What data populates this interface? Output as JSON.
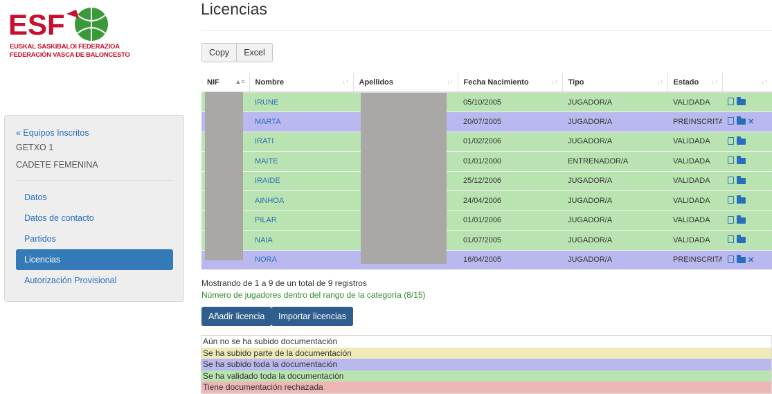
{
  "logo": {
    "acronym": "ESF",
    "line1": "EUSKAL SASKIBALOI FEDERAZIOA",
    "line2": "FEDERACIÓN VASCA DE BALONCESTO"
  },
  "sidebar": {
    "back_link": "« Equipos Inscritos",
    "team": "GETXO 1",
    "category": "CADETE FEMENINA",
    "items": [
      {
        "label": "Datos"
      },
      {
        "label": "Datos de contacto"
      },
      {
        "label": "Partidos"
      },
      {
        "label": "Licencias"
      },
      {
        "label": "Autorización Provisional"
      }
    ]
  },
  "main": {
    "title": "Licencias",
    "export_buttons": {
      "copy": "Copy",
      "excel": "Excel"
    },
    "table": {
      "columns": [
        "NIF",
        "Nombre",
        "Apellidos",
        "Fecha Nacimiento",
        "Tipo",
        "Estado",
        ""
      ],
      "rows": [
        {
          "nif": "",
          "nombre": "IRUNE",
          "apellidos": "",
          "fecha": "05/10/2005",
          "tipo": "JUGADOR/A",
          "estado": "VALIDADA"
        },
        {
          "nif": "",
          "nombre": "MARTA",
          "apellidos": "",
          "fecha": "20/07/2005",
          "tipo": "JUGADOR/A",
          "estado": "PREINSCRITA"
        },
        {
          "nif": "",
          "nombre": "IRATI",
          "apellidos": "",
          "fecha": "01/02/2006",
          "tipo": "JUGADOR/A",
          "estado": "VALIDADA"
        },
        {
          "nif": "",
          "nombre": "MAITE",
          "apellidos": "",
          "fecha": "01/01/2000",
          "tipo": "ENTRENADOR/A",
          "estado": "VALIDADA"
        },
        {
          "nif": "",
          "nombre": "IRAIDE",
          "apellidos": "",
          "fecha": "25/12/2006",
          "tipo": "JUGADOR/A",
          "estado": "VALIDADA"
        },
        {
          "nif": "",
          "nombre": "AINHOA",
          "apellidos": "",
          "fecha": "24/04/2006",
          "tipo": "JUGADOR/A",
          "estado": "VALIDADA"
        },
        {
          "nif": "",
          "nombre": "PILAR",
          "apellidos": "",
          "fecha": "01/01/2006",
          "tipo": "JUGADOR/A",
          "estado": "VALIDADA"
        },
        {
          "nif": "",
          "nombre": "NAIA",
          "apellidos": "",
          "fecha": "01/07/2005",
          "tipo": "JUGADOR/A",
          "estado": "VALIDADA"
        },
        {
          "nif": "",
          "nombre": "NORA",
          "apellidos": "",
          "fecha": "16/04/2005",
          "tipo": "JUGADOR/A",
          "estado": "PREINSCRITA"
        }
      ]
    },
    "info": "Mostrando de 1 a 9 de un total de 9 registros",
    "range_note": "Número de jugadores dentro del rango de la categoría (8/15)",
    "add_button": "Añadir licencia",
    "import_button": "Importar licencias",
    "legend": [
      {
        "label": "Aún no se ha subido documentación",
        "color": "#ffffff"
      },
      {
        "label": "Se ha subido parte de la documentación",
        "color": "#efeab8"
      },
      {
        "label": "Se ha subido toda la documentación",
        "color": "#b9b9ef"
      },
      {
        "label": "Se ha validado toda la documentación",
        "color": "#b9e3b0"
      },
      {
        "label": "Tiene documentación rechazada",
        "color": "#efb6b6"
      }
    ]
  },
  "colors": {
    "accent": "#337ab7",
    "validated_row": "#b9e3b0",
    "preinscribed_row": "#b9b9ef",
    "brand_red": "#c8102e",
    "brand_green": "#3a9a3a"
  }
}
